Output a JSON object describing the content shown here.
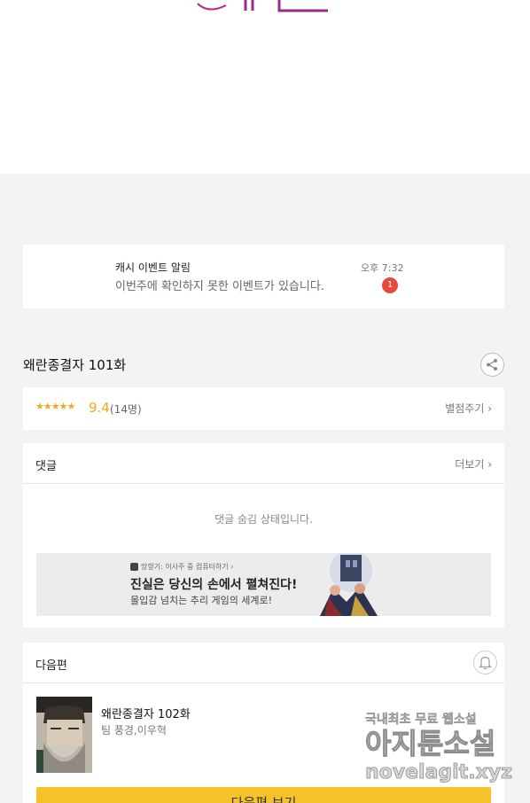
{
  "notice": {
    "title": "캐시 이벤트 알림",
    "message": "이번주에 확인하지 못한 이벤트가 있습니다.",
    "time": "오후 7:32",
    "badge": "1"
  },
  "episode": {
    "title": "왜란종결자 101화"
  },
  "rating": {
    "stars": "★★★★★",
    "score": "9.4",
    "count": "(14명)",
    "rate_label": "별점주기 ›"
  },
  "comments": {
    "title": "댓글",
    "more_label": "더보기 ›",
    "hidden_message": "댓글 숨김 상태입니다."
  },
  "ad": {
    "small_text": "망향기: 이사주 중 컴퓨터하기 ›",
    "headline": "진실은 당신의 손에서 펼쳐진다!",
    "subtext": "몰입감 넘치는 추리 게임의 세계로!"
  },
  "next_episode": {
    "section_title": "다음편",
    "title": "왜란종결자 102화",
    "authors": "팀 풍경,이우혁",
    "button_label": "다음편 보기"
  },
  "watermark": {
    "line1": "국내최초 무료 웹소설",
    "line2": "아지툰소설",
    "line3": "novelagit.xyz"
  },
  "colors": {
    "accent": "#f2a91e",
    "badge": "#e8493b",
    "button": "#f6c229"
  }
}
